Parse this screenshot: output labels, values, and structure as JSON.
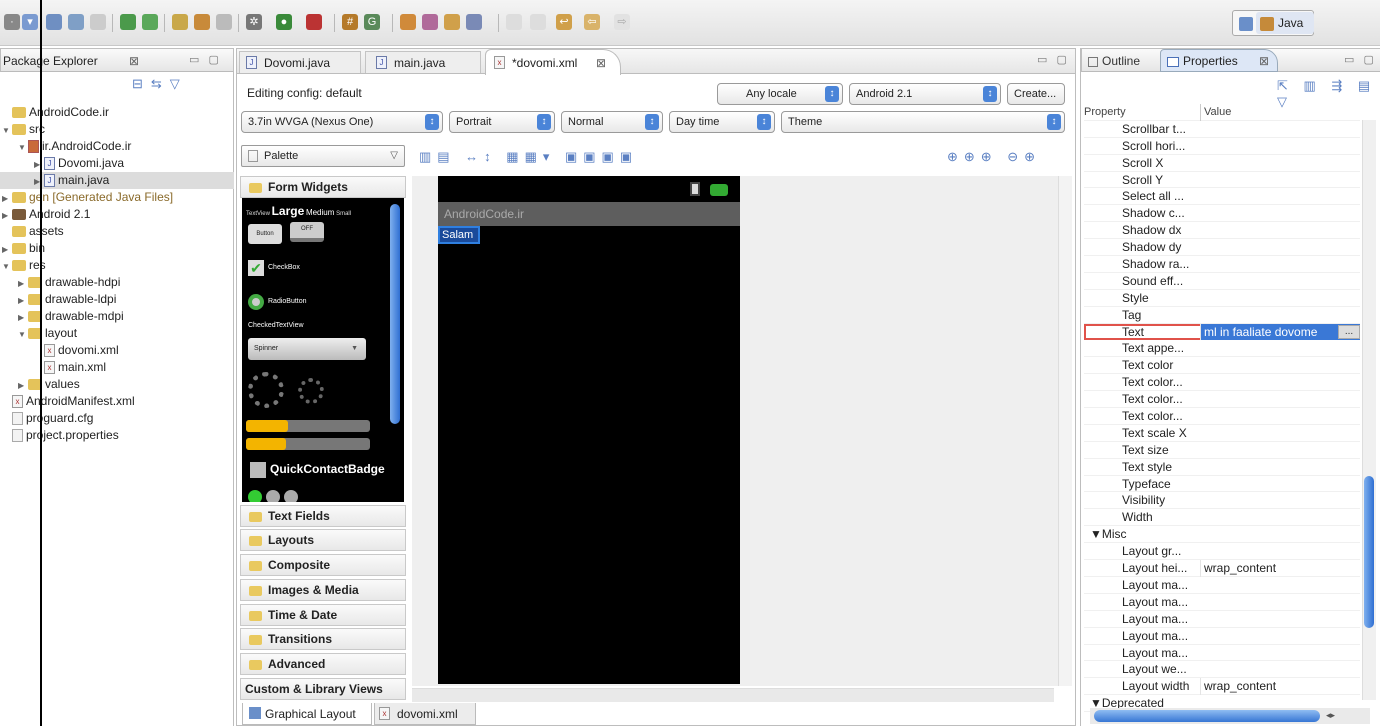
{
  "perspective": {
    "label": "Java"
  },
  "package_explorer": {
    "title": "Package Explorer",
    "items": [
      {
        "label": "AndroidCode.ir",
        "indent": 0,
        "icon": "project-icon",
        "expand": ""
      },
      {
        "label": "src",
        "indent": 0,
        "icon": "folder-icon",
        "expand": "▼"
      },
      {
        "label": "ir.AndroidCode.ir",
        "indent": 1,
        "icon": "package-icon",
        "expand": "▼"
      },
      {
        "label": "Dovomi.java",
        "indent": 2,
        "icon": "java-file-icon",
        "expand": "▶"
      },
      {
        "label": "main.java",
        "indent": 2,
        "icon": "java-file-icon",
        "expand": "▶",
        "selected": true
      },
      {
        "label": "gen [Generated Java Files]",
        "indent": 0,
        "icon": "folder-icon",
        "expand": "▶"
      },
      {
        "label": "Android 2.1",
        "indent": 0,
        "icon": "library-icon",
        "expand": "▶"
      },
      {
        "label": "assets",
        "indent": 0,
        "icon": "folder-icon",
        "expand": ""
      },
      {
        "label": "bin",
        "indent": 0,
        "icon": "folder-icon",
        "expand": "▶"
      },
      {
        "label": "res",
        "indent": 0,
        "icon": "folder-icon",
        "expand": "▼"
      },
      {
        "label": "drawable-hdpi",
        "indent": 1,
        "icon": "folder-icon",
        "expand": "▶"
      },
      {
        "label": "drawable-ldpi",
        "indent": 1,
        "icon": "folder-icon",
        "expand": "▶"
      },
      {
        "label": "drawable-mdpi",
        "indent": 1,
        "icon": "folder-icon",
        "expand": "▶"
      },
      {
        "label": "layout",
        "indent": 1,
        "icon": "folder-icon",
        "expand": "▼"
      },
      {
        "label": "dovomi.xml",
        "indent": 2,
        "icon": "xml-file-icon",
        "expand": ""
      },
      {
        "label": "main.xml",
        "indent": 2,
        "icon": "xml-file-icon",
        "expand": ""
      },
      {
        "label": "values",
        "indent": 1,
        "icon": "folder-icon",
        "expand": "▶"
      },
      {
        "label": "AndroidManifest.xml",
        "indent": 0,
        "icon": "xml-file-icon",
        "expand": ""
      },
      {
        "label": "proguard.cfg",
        "indent": 0,
        "icon": "file-icon",
        "expand": ""
      },
      {
        "label": "project.properties",
        "indent": 0,
        "icon": "file-icon",
        "expand": ""
      }
    ]
  },
  "editor": {
    "tabs": [
      "Dovomi.java",
      "main.java",
      "*dovomi.xml"
    ],
    "editing_config": "Editing config:  default",
    "locale": "Any locale",
    "api": "Android 2.1",
    "create": "Create...",
    "device": "3.7in WVGA (Nexus One)",
    "orientation": "Portrait",
    "mode": "Normal",
    "time": "Day time",
    "theme": "Theme",
    "palette_title": "Palette",
    "bottom_tabs": [
      "Graphical Layout",
      "dovomi.xml"
    ]
  },
  "palette": {
    "sections": [
      "Form Widgets",
      "Text Fields",
      "Layouts",
      "Composite",
      "Images & Media",
      "Time & Date",
      "Transitions",
      "Advanced"
    ],
    "custom": "Custom & Library Views",
    "widgets": {
      "textview": "TextView",
      "large": "Large",
      "medium": "Medium",
      "small": "Small",
      "button": "Button",
      "toggle": "OFF",
      "checkbox": "CheckBox",
      "radio": "RadioButton",
      "checkedtext": "CheckedTextView",
      "spinner": "Spinner",
      "quick": "QuickContactBadge"
    }
  },
  "phone": {
    "app_title": "AndroidCode.ir",
    "text": "Salam"
  },
  "properties_view": {
    "tabs": [
      "Outline",
      "Properties"
    ],
    "col_property": "Property",
    "col_value": "Value",
    "rows": [
      {
        "name": "Scrollbar t...",
        "value": ""
      },
      {
        "name": "Scroll hori...",
        "value": ""
      },
      {
        "name": "Scroll X",
        "value": ""
      },
      {
        "name": "Scroll Y",
        "value": ""
      },
      {
        "name": "Select all ...",
        "value": ""
      },
      {
        "name": "Shadow c...",
        "value": ""
      },
      {
        "name": "Shadow dx",
        "value": ""
      },
      {
        "name": "Shadow dy",
        "value": ""
      },
      {
        "name": "Shadow ra...",
        "value": ""
      },
      {
        "name": "Sound eff...",
        "value": ""
      },
      {
        "name": "Style",
        "value": ""
      },
      {
        "name": "Tag",
        "value": ""
      },
      {
        "name": "Text",
        "value": "ml in faaliate dovome",
        "highlight": true
      },
      {
        "name": "Text appe...",
        "value": ""
      },
      {
        "name": "Text color",
        "value": ""
      },
      {
        "name": "Text color...",
        "value": ""
      },
      {
        "name": "Text color...",
        "value": ""
      },
      {
        "name": "Text color...",
        "value": ""
      },
      {
        "name": "Text scale X",
        "value": ""
      },
      {
        "name": "Text size",
        "value": ""
      },
      {
        "name": "Text style",
        "value": ""
      },
      {
        "name": "Typeface",
        "value": ""
      },
      {
        "name": "Visibility",
        "value": ""
      },
      {
        "name": "Width",
        "value": ""
      },
      {
        "name": "▼Misc",
        "value": "",
        "group": true
      },
      {
        "name": "Layout gr...",
        "value": ""
      },
      {
        "name": "Layout hei...",
        "value": "wrap_content"
      },
      {
        "name": "Layout ma...",
        "value": ""
      },
      {
        "name": "Layout ma...",
        "value": ""
      },
      {
        "name": "Layout ma...",
        "value": ""
      },
      {
        "name": "Layout ma...",
        "value": ""
      },
      {
        "name": "Layout ma...",
        "value": ""
      },
      {
        "name": "Layout we...",
        "value": ""
      },
      {
        "name": "Layout width",
        "value": "wrap_content"
      },
      {
        "name": "▼Deprecated",
        "value": "",
        "group": true
      }
    ]
  }
}
